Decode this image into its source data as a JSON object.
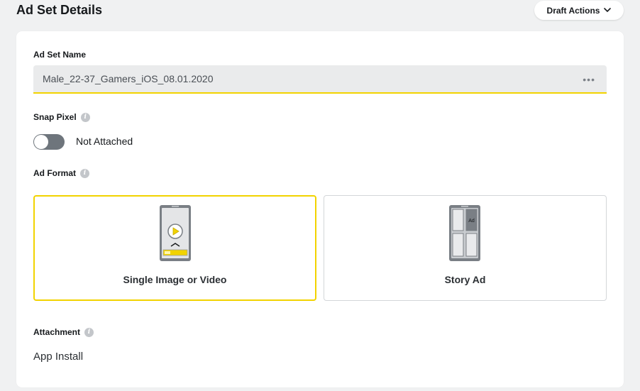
{
  "header": {
    "title": "Ad Set Details",
    "draft_actions_label": "Draft Actions"
  },
  "ad_set_name": {
    "label": "Ad Set Name",
    "value": "Male_22-37_Gamers_iOS_08.01.2020",
    "more_glyph": "•••"
  },
  "snap_pixel": {
    "label": "Snap Pixel",
    "toggle_on": false,
    "status_text": "Not Attached"
  },
  "ad_format": {
    "label": "Ad Format",
    "options": [
      {
        "label": "Single Image or Video",
        "selected": true,
        "icon": "phone-play-icon"
      },
      {
        "label": "Story Ad",
        "selected": false,
        "icon": "phone-story-grid-icon",
        "badge": "Ad"
      }
    ]
  },
  "attachment": {
    "label": "Attachment",
    "value": "App Install"
  },
  "colors": {
    "accent_yellow": "#f2d300",
    "toggle_off": "#6e757c",
    "page_bg": "#f0f1f2"
  }
}
